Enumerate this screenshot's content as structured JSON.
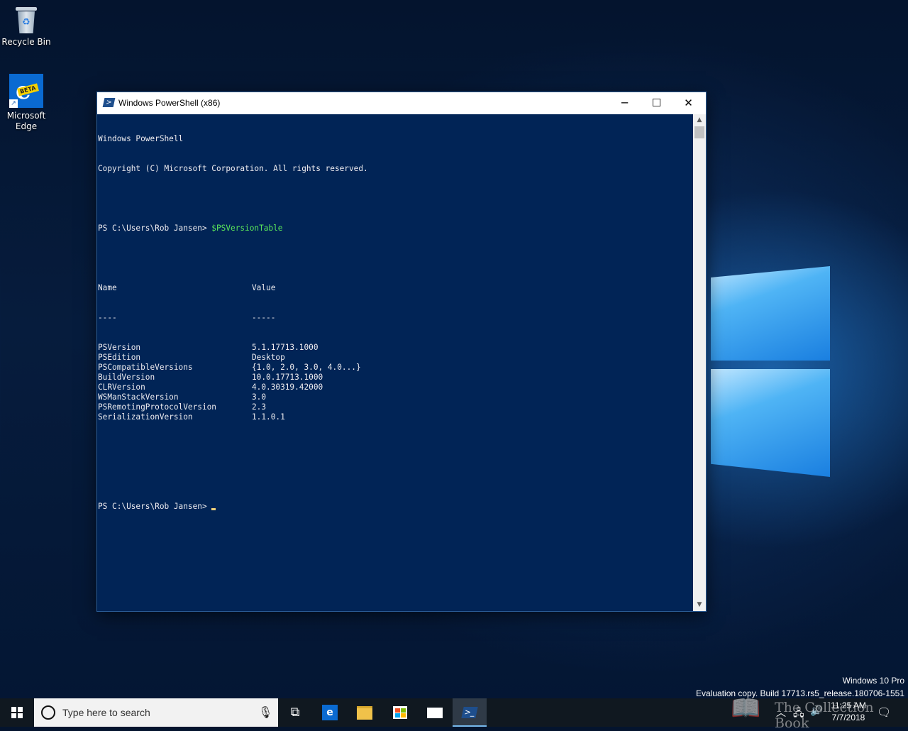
{
  "desktop": {
    "icons": [
      {
        "label": "Recycle Bin"
      },
      {
        "label": "Microsoft Edge",
        "label_line1": "Microsoft",
        "label_line2": "Edge",
        "badge": "BETA"
      }
    ]
  },
  "window": {
    "title": "Windows PowerShell (x86)",
    "buttons": {
      "minimize": "─",
      "maximize": "☐",
      "close": "✕"
    },
    "console": {
      "banner_line1": "Windows PowerShell",
      "banner_line2": "Copyright (C) Microsoft Corporation. All rights reserved.",
      "prompt": "PS C:\\Users\\Rob Jansen> ",
      "command": "$PSVersionTable",
      "table": {
        "headers": [
          "Name",
          "Value"
        ],
        "underline": [
          "----",
          "-----"
        ],
        "rows": [
          [
            "PSVersion",
            "5.1.17713.1000"
          ],
          [
            "PSEdition",
            "Desktop"
          ],
          [
            "PSCompatibleVersions",
            "{1.0, 2.0, 3.0, 4.0...}"
          ],
          [
            "BuildVersion",
            "10.0.17713.1000"
          ],
          [
            "CLRVersion",
            "4.0.30319.42000"
          ],
          [
            "WSManStackVersion",
            "3.0"
          ],
          [
            "PSRemotingProtocolVersion",
            "2.3"
          ],
          [
            "SerializationVersion",
            "1.1.0.1"
          ]
        ]
      },
      "final_prompt": "PS C:\\Users\\Rob Jansen> "
    }
  },
  "watermark": {
    "edition": "Windows 10 Pro",
    "build": "Evaluation copy. Build 17713.rs5_release.180706-1551",
    "brand": "The Collection Book"
  },
  "taskbar": {
    "search_placeholder": "Type here to search",
    "edge_badge": "e",
    "ps_glyph": ">_",
    "clock": {
      "time": "11:25 AM",
      "date": "7/7/2018"
    }
  }
}
